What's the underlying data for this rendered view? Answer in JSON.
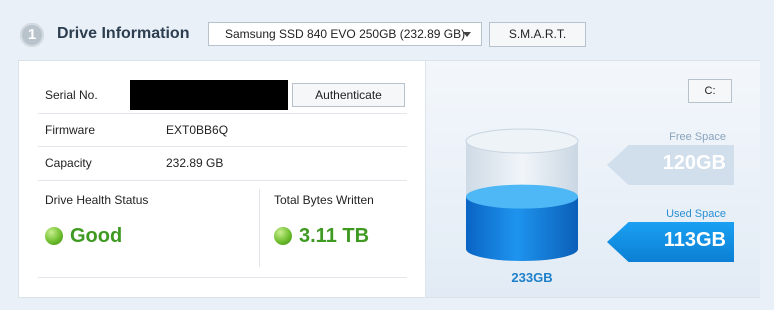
{
  "section": {
    "number": "1",
    "title": "Drive Information"
  },
  "drive_select": {
    "selected": "Samsung SSD 840 EVO 250GB (232.89 GB)"
  },
  "toolbar": {
    "smart_label": "S.M.A.R.T."
  },
  "info": {
    "serial_label": "Serial No.",
    "authenticate_label": "Authenticate",
    "firmware_label": "Firmware",
    "firmware_value": "EXT0BB6Q",
    "capacity_label": "Capacity",
    "capacity_value": "232.89 GB",
    "health_label": "Drive Health Status",
    "health_value": "Good",
    "tbw_label": "Total Bytes Written",
    "tbw_value": "3.11 TB"
  },
  "space": {
    "drive_letter": "C:",
    "free_label": "Free Space",
    "free_value": "120GB",
    "used_label": "Used Space",
    "used_value": "113GB",
    "total_value": "233GB",
    "used_fraction": 0.485
  },
  "colors": {
    "accent_blue": "#0b86db",
    "good_green": "#3f9a22",
    "free_gray": "#d1deec"
  },
  "icons": {
    "health_indicator": "green-dot-icon",
    "dropdown": "chevron-down-icon",
    "storage": "cylinder-icon"
  }
}
